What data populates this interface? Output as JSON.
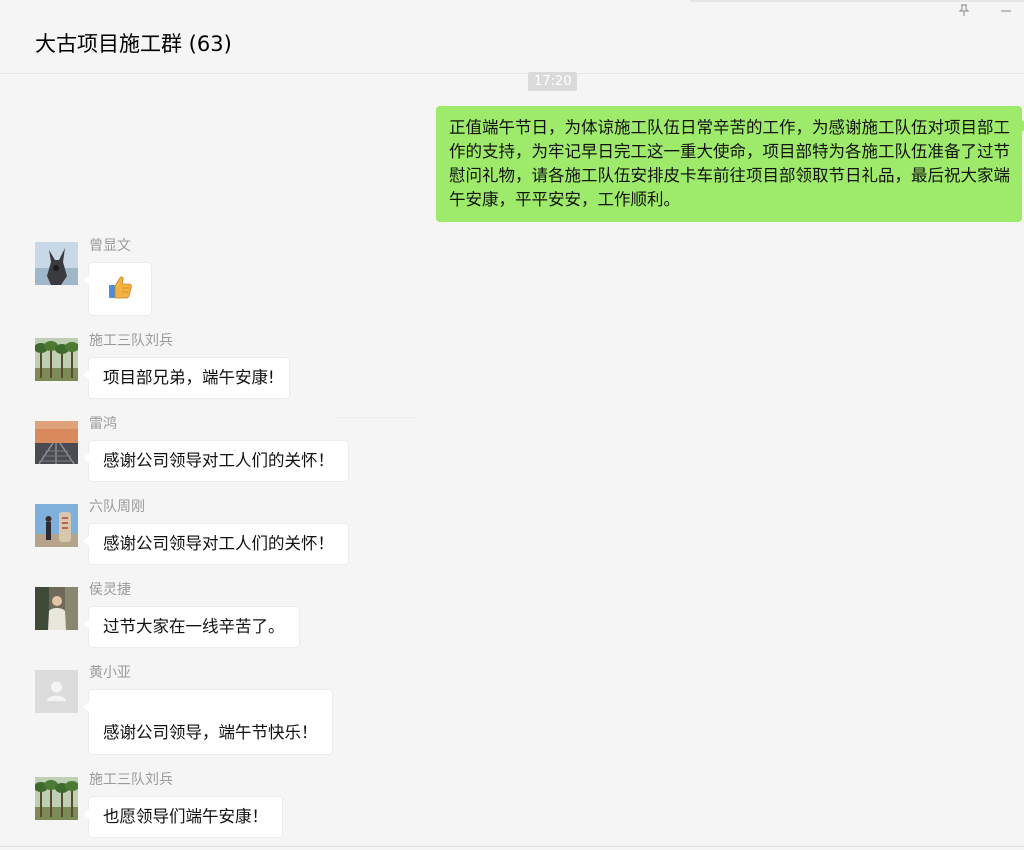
{
  "window": {
    "title": "大古项目施工群 (63)",
    "pin_icon": "pin-icon",
    "minimize_icon": "minimize-icon"
  },
  "chat": {
    "time": "17:20",
    "own_message": "正值端午节日，为体谅施工队伍日常辛苦的工作，为感谢施工队伍对项目部工作的支持，为牢记早日完工这一重大使命，项目部特为各施工队伍准备了过节慰问礼物，请各施工队伍安排皮卡车前往项目部领取节日礼品，最后祝大家端午安康，平平安安，工作顺利。",
    "messages": [
      {
        "sender": "曾显文",
        "text": "",
        "sticker": "thumbs-up-icon"
      },
      {
        "sender": "施工三队刘兵",
        "text": "项目部兄弟，端午安康!"
      },
      {
        "sender": "雷鸿",
        "text": "感谢公司领导对工人们的关怀！"
      },
      {
        "sender": "六队周刚",
        "text": "感谢公司领导对工人们的关怀！"
      },
      {
        "sender": "侯灵捷",
        "text": "过节大家在一线辛苦了。"
      },
      {
        "sender": "黄小亚",
        "text": "感谢公司领导，端午节快乐！"
      },
      {
        "sender": "施工三队刘兵",
        "text": "也愿领导们端午安康！"
      }
    ]
  }
}
